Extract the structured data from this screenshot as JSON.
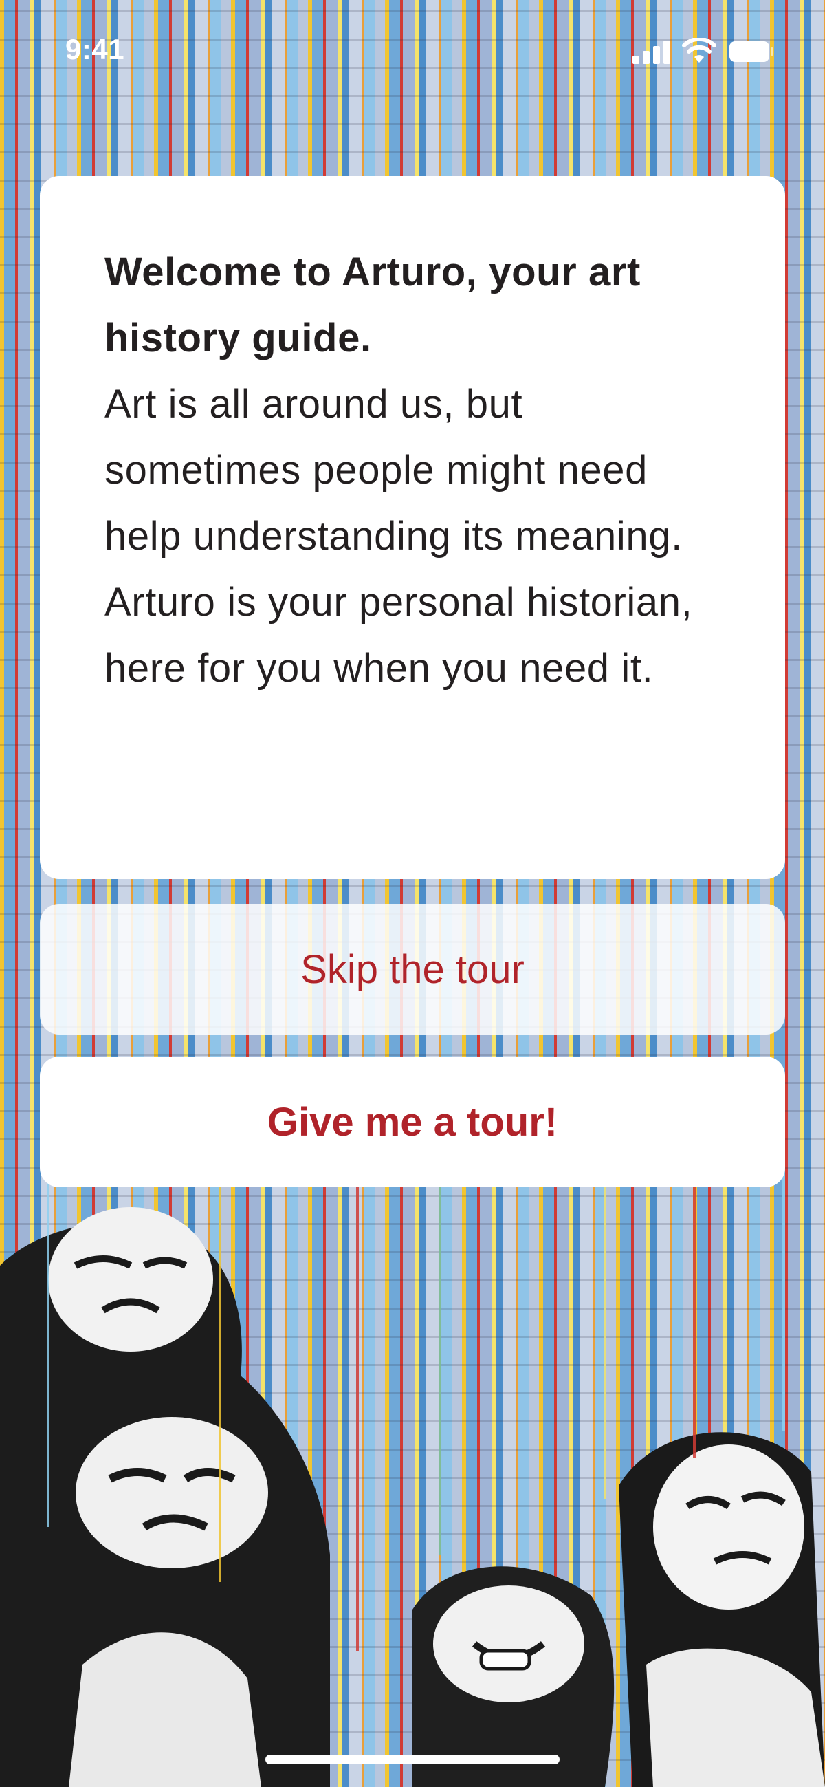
{
  "status_bar": {
    "time": "9:41"
  },
  "welcome_card": {
    "title": "Welcome to Arturo, your art history guide.",
    "body": "Art is all around us, but sometimes people might need help understanding its meaning. Arturo is your personal historian, here for you when you need it."
  },
  "actions": {
    "skip_label": "Skip the tour",
    "tour_label": "Give me a tour!"
  },
  "colors": {
    "accent": "#b0232a",
    "text_primary": "#231f20",
    "card_background": "#ffffff"
  },
  "icons": [
    "signal-icon",
    "wifi-icon",
    "battery-icon"
  ]
}
